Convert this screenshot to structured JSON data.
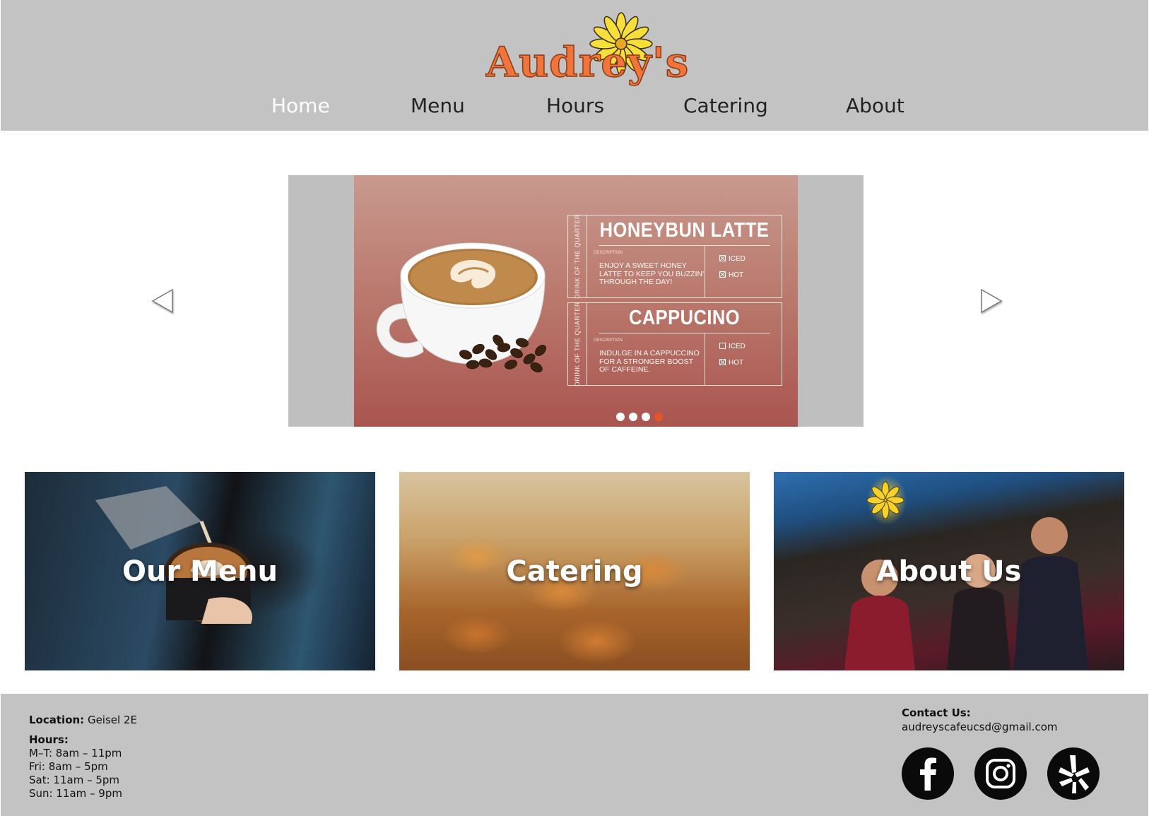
{
  "header": {
    "logo_text": "Audrey's",
    "nav": [
      {
        "label": "Home",
        "active": true
      },
      {
        "label": "Menu",
        "active": false
      },
      {
        "label": "Hours",
        "active": false
      },
      {
        "label": "Catering",
        "active": false
      },
      {
        "label": "About",
        "active": false
      }
    ]
  },
  "carousel": {
    "active_slide": 4,
    "slide_count": 4,
    "slide": {
      "items": [
        {
          "side_label": "DRINK OF THE QUARTER",
          "name": "HONEYBUN LATTE",
          "desc_label": "DESCRIPTION",
          "description": "ENJOY A SWEET HONEY LATTE TO KEEP YOU BUZZIN' THROUGH THE DAY!",
          "options": [
            {
              "label": "ICED",
              "checked": true
            },
            {
              "label": "HOT",
              "checked": true
            }
          ]
        },
        {
          "side_label": "DRINK OF THE QUARTER",
          "name": "CAPPUCINO",
          "desc_label": "DESCRIPTION",
          "description": "INDULGE IN A CAPPUCCINO FOR A STRONGER BOOST OF CAFFEINE.",
          "options": [
            {
              "label": "ICED",
              "checked": false
            },
            {
              "label": "HOT",
              "checked": true
            }
          ]
        }
      ]
    }
  },
  "tiles": [
    {
      "label": "Our Menu"
    },
    {
      "label": "Catering"
    },
    {
      "label": "About Us"
    }
  ],
  "footer": {
    "location_label": "Location:",
    "location_value": "Geisel 2E",
    "hours_label": "Hours:",
    "hours": [
      "M–T: 8am – 11pm",
      "Fri: 8am – 5pm",
      "Sat: 11am – 5pm",
      "Sun: 11am – 9pm"
    ],
    "contact_label": "Contact Us:",
    "contact_email": "audreyscafeucsd@gmail.com",
    "social": [
      "facebook-icon",
      "instagram-icon",
      "yelp-icon"
    ]
  },
  "colors": {
    "bar_gray": "#c3c3c3",
    "logo_orange": "#f0743c",
    "flower_yellow": "#f6df3a",
    "active_dot": "#e3552b"
  }
}
